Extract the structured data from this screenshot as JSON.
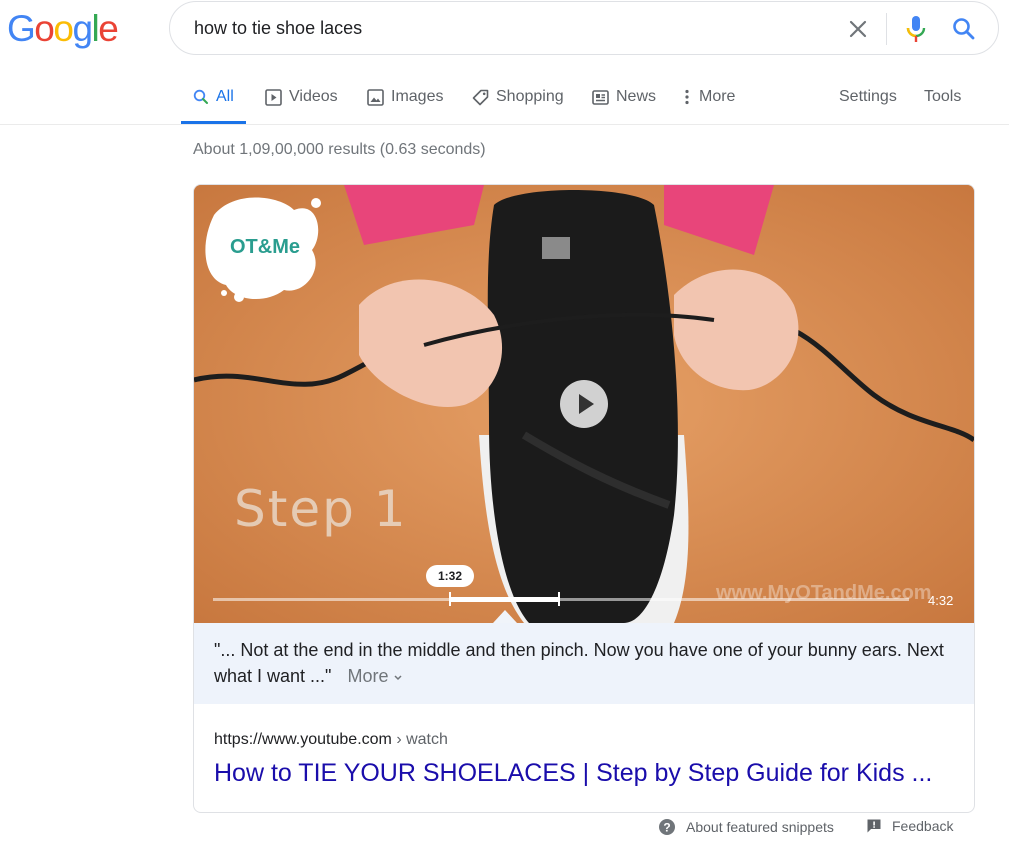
{
  "logo": {
    "letters": [
      "G",
      "o",
      "o",
      "g",
      "l",
      "e"
    ],
    "colors": [
      "#4285f4",
      "#ea4335",
      "#fbbc05",
      "#4285f4",
      "#34a853",
      "#ea4335"
    ]
  },
  "search": {
    "query": "how to tie shoe laces"
  },
  "icons": {
    "clear": "close-icon",
    "mic": "mic-icon",
    "search": "search-icon"
  },
  "tabs": {
    "items": [
      {
        "label": "All",
        "icon": "search-icon",
        "active": true
      },
      {
        "label": "Videos",
        "icon": "play-icon"
      },
      {
        "label": "Images",
        "icon": "image-icon"
      },
      {
        "label": "Shopping",
        "icon": "tag-icon"
      },
      {
        "label": "News",
        "icon": "news-icon"
      },
      {
        "label": "More",
        "icon": "more-vert-icon"
      }
    ],
    "settings": "Settings",
    "tools": "Tools"
  },
  "stats": "About 1,09,00,000 results (0.63 seconds)",
  "video": {
    "logo_text": "OT&Me",
    "overlay_text": "Step 1",
    "watermark": "www.MyOTandMe.com",
    "clip_time": "1:32",
    "duration": "4:32"
  },
  "snippet": {
    "transcript": "\"... Not at the end in the middle and then pinch. Now you have one of your bunny ears. Next what I want ...\"",
    "more": "More",
    "url": "https://www.youtube.com",
    "url_path": "› watch",
    "title": "How to TIE YOUR SHOELACES | Step by Step Guide for Kids ..."
  },
  "footer": {
    "about": "About featured snippets",
    "feedback": "Feedback"
  },
  "colors": {
    "accent": "#1a73e8",
    "link": "#1a0dab"
  }
}
